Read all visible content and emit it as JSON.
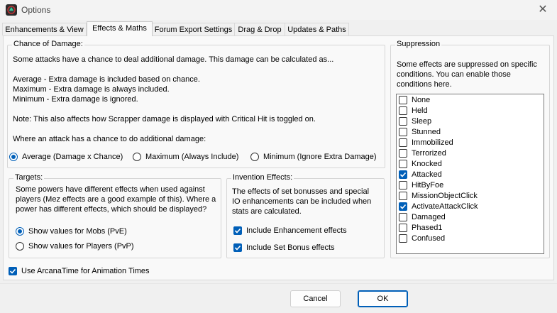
{
  "window": {
    "title": "Options",
    "close_glyph": "✕"
  },
  "tabs": [
    {
      "label": "Enhancements & View",
      "active": false
    },
    {
      "label": "Effects & Maths",
      "active": true
    },
    {
      "label": "Forum Export Settings",
      "active": false
    },
    {
      "label": "Drag & Drop",
      "active": false
    },
    {
      "label": "Updates & Paths",
      "active": false
    }
  ],
  "chance": {
    "legend": "Chance of Damage:",
    "intro": "Some attacks have a chance to deal additional damage. This damage can be calculated as...",
    "average_desc": "Average - Extra damage is included based on chance.",
    "maximum_desc": "Maximum - Extra damage is always included.",
    "minimum_desc": "Minimum - Extra damage is ignored.",
    "note": "Note: This also affects how Scrapper damage is displayed with Critical Hit is toggled on.",
    "prompt": "Where an attack has a chance to do additional damage:",
    "options": [
      {
        "label": "Average (Damage x Chance)",
        "selected": true
      },
      {
        "label": "Maximum (Always Include)",
        "selected": false
      },
      {
        "label": "Minimum (Ignore Extra Damage)",
        "selected": false
      }
    ]
  },
  "targets": {
    "legend": "Targets:",
    "line1": "Some powers  have different effects when used against",
    "line2": "players (Mez effects are a good example of this). Where a",
    "line3": "power has different effects, which should be displayed?",
    "options": [
      {
        "label": "Show values for Mobs (PvE)",
        "selected": true
      },
      {
        "label": "Show values for Players (PvP)",
        "selected": false
      }
    ]
  },
  "invention": {
    "legend": "Invention Effects:",
    "line1": "The effects of set bonusses and special",
    "line2": "IO enhancements can be included when",
    "line3": "stats are calculated.",
    "checks": [
      {
        "label": "Include Enhancement effects",
        "checked": true
      },
      {
        "label": "Include Set Bonus effects",
        "checked": true
      }
    ]
  },
  "suppression": {
    "legend": "Suppression",
    "line1": "Some effects are suppressed on specific",
    "line2": "conditions. You can enable those",
    "line3": "conditions here.",
    "items": [
      {
        "label": "None",
        "checked": false
      },
      {
        "label": "Held",
        "checked": false
      },
      {
        "label": "Sleep",
        "checked": false
      },
      {
        "label": "Stunned",
        "checked": false
      },
      {
        "label": "Immobilized",
        "checked": false
      },
      {
        "label": "Terrorized",
        "checked": false
      },
      {
        "label": "Knocked",
        "checked": false
      },
      {
        "label": "Attacked",
        "checked": true
      },
      {
        "label": "HitByFoe",
        "checked": false
      },
      {
        "label": "MissionObjectClick",
        "checked": false
      },
      {
        "label": "ActivateAttackClick",
        "checked": true
      },
      {
        "label": "Damaged",
        "checked": false
      },
      {
        "label": "Phased1",
        "checked": false
      },
      {
        "label": "Confused",
        "checked": false
      }
    ]
  },
  "arcana": {
    "label": "Use ArcanaTime for Animation Times",
    "checked": true
  },
  "buttons": {
    "cancel": "Cancel",
    "ok": "OK"
  },
  "colors": {
    "accent": "#005fb8",
    "background": "#f0f0f0",
    "panel": "#f9f9f9"
  }
}
